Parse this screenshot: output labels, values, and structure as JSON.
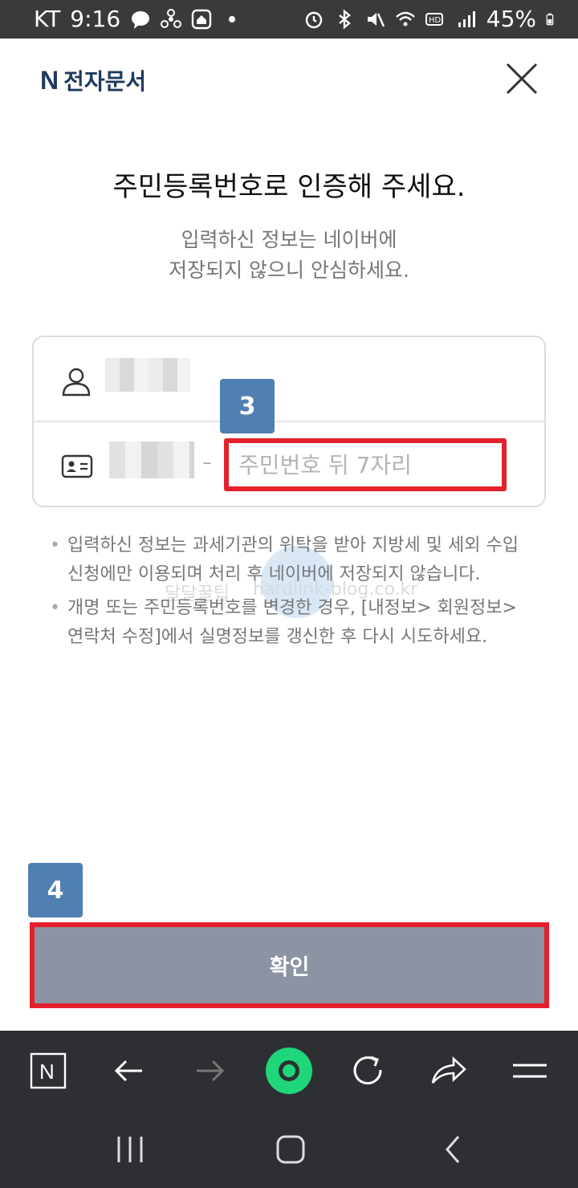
{
  "status_bar": {
    "carrier": "KT",
    "time": "9:16",
    "battery": "45%"
  },
  "header": {
    "brand_letter": "N",
    "brand_title": "전자문서",
    "close_icon": "close-icon"
  },
  "main": {
    "title": "주민등록번호로 인증해 주세요.",
    "subtitle_line1": "입력하신 정보는 네이버에",
    "subtitle_line2": "저장되지 않으니 안심하세요."
  },
  "form": {
    "rrn_dash": "–",
    "rrn_back_placeholder": "주민번호 뒤 7자리"
  },
  "steps": {
    "step3": "3",
    "step4": "4"
  },
  "notices": [
    "입력하신 정보는 과세기관의 위탁을 받아 지방세 및 세외 수입 신청에만 이용되며 처리 후 네이버에 저장되지 않습니다.",
    "개명 또는 주민등록번호를 변경한 경우, [내정보> 회원정보> 연락처 수정]에서 실명정보를 갱신한 후 다시 시도하세요."
  ],
  "watermark": {
    "text_a": "달달꿀팁",
    "text_b": "hardlink-blog.co.kr"
  },
  "confirm_button": "확인",
  "browser_toolbar": {
    "home_letter": "N"
  },
  "colors": {
    "brand": "#1e3a5f",
    "highlight_red": "#e3202c",
    "step_badge": "#4f7fb3",
    "confirm_bg": "#8c93a3",
    "green_button": "#1fd67a"
  }
}
